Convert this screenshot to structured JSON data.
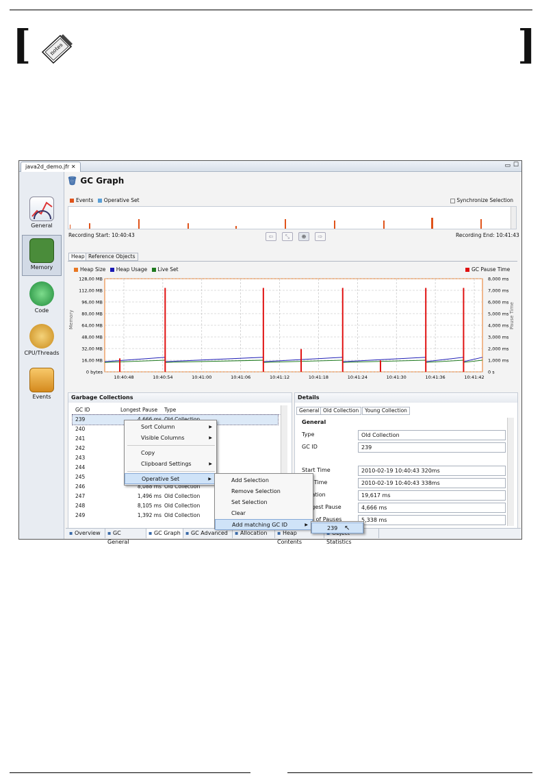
{
  "notes_icon": "notes-icon",
  "window": {
    "file_tab": "java2d_demo.jfr",
    "page_title": "GC Graph"
  },
  "sidebar": [
    {
      "label": "General",
      "icon": "gauge-icon"
    },
    {
      "label": "Memory",
      "icon": "memory-chip-icon"
    },
    {
      "label": "Code",
      "icon": "code-icon"
    },
    {
      "label": "CPU/Threads",
      "icon": "cpu-gear-icon"
    },
    {
      "label": "Events",
      "icon": "events-box-icon"
    }
  ],
  "overview": {
    "legend_events": "Events",
    "legend_operative": "Operative Set",
    "sync_label": "Synchronize Selection",
    "recording_start": "Recording Start: 10:40:43",
    "recording_end": "Recording End: 10:41:43",
    "colors": {
      "events": "#e0531a",
      "operative": "#5a9fd6"
    }
  },
  "chart_tabs": [
    "Heap",
    "Reference Objects"
  ],
  "chart_data": {
    "type": "line",
    "legend": [
      "Heap Size",
      "Heap Usage",
      "Live Set",
      "GC Pause Time"
    ],
    "colors": {
      "heap_size": "#e87722",
      "heap_usage": "#1a1ab4",
      "live_set": "#1e7a1e",
      "gc_pause": "#e01010"
    },
    "ylabel": "Memory",
    "y2label": "Pause Time",
    "yticks": [
      "128,00 MB",
      "112,00 MB",
      "96,00 MB",
      "80,00 MB",
      "64,00 MB",
      "48,00 MB",
      "32,00 MB",
      "16,00 MB",
      "0 bytes"
    ],
    "y2ticks": [
      "8,000 ms",
      "7,000 ms",
      "6,000 ms",
      "5,000 ms",
      "4,000 ms",
      "3,000 ms",
      "2,000 ms",
      "1,000 ms",
      "0 s"
    ],
    "xticks": [
      "10:40:48",
      "10:40:54",
      "10:41:00",
      "10:41:06",
      "10:41:12",
      "10:41:18",
      "10:41:24",
      "10:41:30",
      "10:41:36",
      "10:41:42"
    ],
    "pauses": [
      {
        "t": 0.04,
        "v": 1300
      },
      {
        "t": 0.16,
        "v": 8100
      },
      {
        "t": 0.42,
        "v": 8100
      },
      {
        "t": 0.52,
        "v": 2200
      },
      {
        "t": 0.63,
        "v": 8100
      },
      {
        "t": 0.73,
        "v": 1100
      },
      {
        "t": 0.85,
        "v": 8100
      },
      {
        "t": 0.95,
        "v": 8100
      }
    ]
  },
  "gc_panel": {
    "title": "Garbage Collections",
    "headers": [
      "GC ID",
      "Longest Pause",
      "Type"
    ],
    "rows": [
      {
        "id": "239",
        "pause": "4,666 ms",
        "type": "Old Collection"
      },
      {
        "id": "240",
        "pause": "",
        "type": ""
      },
      {
        "id": "241",
        "pause": "",
        "type": ""
      },
      {
        "id": "242",
        "pause": "",
        "type": ""
      },
      {
        "id": "243",
        "pause": "",
        "type": ""
      },
      {
        "id": "244",
        "pause": "",
        "type": ""
      },
      {
        "id": "245",
        "pause": "",
        "type": ""
      },
      {
        "id": "246",
        "pause": "8,088 ms",
        "type": "Old Collection"
      },
      {
        "id": "247",
        "pause": "1,496 ms",
        "type": "Old Collection"
      },
      {
        "id": "248",
        "pause": "8,105 ms",
        "type": "Old Collection"
      },
      {
        "id": "249",
        "pause": "1,392 ms",
        "type": "Old Collection"
      }
    ]
  },
  "context_menu": {
    "items": [
      "Sort Column",
      "Visible Columns",
      "Copy",
      "Clipboard Settings",
      "Operative Set"
    ],
    "submenu": [
      "Add Selection",
      "Remove Selection",
      "Set Selection",
      "Clear",
      "Add matching GC ID"
    ],
    "subsubmenu": [
      "239"
    ]
  },
  "details": {
    "title": "Details",
    "tabs": [
      "General",
      "Old Collection",
      "Young Collection"
    ],
    "section": "General",
    "fields": [
      {
        "label": "Type",
        "value": "Old Collection"
      },
      {
        "label": "GC ID",
        "value": "239"
      },
      {
        "label": "Start Time",
        "value": "2010-02-19 10:40:43 320ms"
      },
      {
        "label": "End Time",
        "value": "2010-02-19 10:40:43 338ms"
      },
      {
        "label": "Duration",
        "value": "19,617 ms"
      },
      {
        "label": "Longest Pause",
        "value": "4,666 ms"
      },
      {
        "label": "Sum of Pauses",
        "value": "5,338 ms"
      }
    ]
  },
  "bottom_tabs": [
    "Overview",
    "GC General",
    "GC Graph",
    "GC Advanced",
    "Allocation",
    "Heap Contents",
    "Object Statistics"
  ]
}
